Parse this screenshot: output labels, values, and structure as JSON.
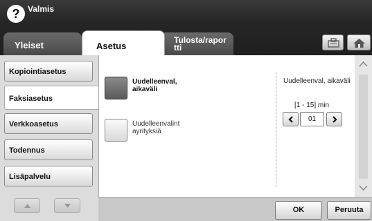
{
  "header": {
    "help_label": "?",
    "status": "Valmis"
  },
  "tabs": [
    {
      "label": "Yleiset",
      "active": false
    },
    {
      "label": "Asetus",
      "active": true
    },
    {
      "label": "Tulosta/raporⁿtti",
      "active": false
    }
  ],
  "tab_print_label": "Tulosta/rapor tti",
  "header_buttons": {
    "job_icon": "job-status-icon",
    "home_icon": "home-icon"
  },
  "sidebar": {
    "items": [
      {
        "label": "Kopiointiasetus",
        "active": false
      },
      {
        "label": "Faksiasetus",
        "active": true
      },
      {
        "label": "Verkkoasetus",
        "active": false
      },
      {
        "label": "Todennus",
        "active": false
      },
      {
        "label": "Lisäpalvelu",
        "active": false
      }
    ],
    "scroll_up_icon": "triangle-up-icon",
    "scroll_down_icon": "triangle-down-icon"
  },
  "main": {
    "options": [
      {
        "label": "Uudelleenval, aikaväli",
        "selected": true
      },
      {
        "label": "Uudelleenvalint ayrityksiä",
        "selected": false
      }
    ],
    "detail": {
      "title": "Uudelleenval, aikaväli",
      "range": "[1 - 15] min",
      "value": "01"
    }
  },
  "footer": {
    "ok": "OK",
    "cancel": "Peruuta"
  },
  "colors": {
    "header_bg": "#262626",
    "panel_bg": "#ffffff",
    "frame_bg": "#dcdcdc"
  }
}
